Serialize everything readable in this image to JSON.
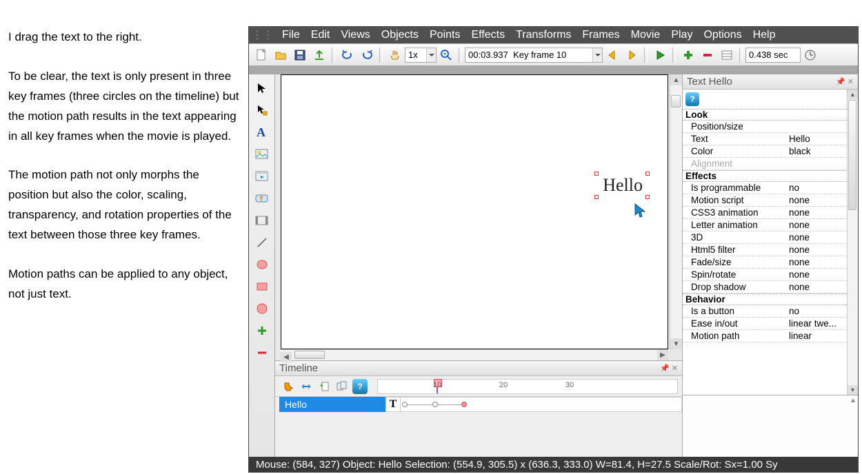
{
  "tutorial": {
    "p1": "I drag the text to the right.",
    "p2": "To be clear, the text is only present in three key frames (three circles on the timeline) but the motion path results in the text appearing in all key frames when the movie is played.",
    "p3": "The motion path not only morphs the position but also the color, scaling, transparency, and rotation properties of the text between those three key frames.",
    "p4": "Motion paths can be applied to any object, not just text."
  },
  "menu": [
    "File",
    "Edit",
    "Views",
    "Objects",
    "Points",
    "Effects",
    "Transforms",
    "Frames",
    "Movie",
    "Play",
    "Options",
    "Help"
  ],
  "toolbar": {
    "zoom": "1x",
    "time": "00:03.937",
    "frame": "Key frame 10",
    "duration": "0.438 sec"
  },
  "canvas_text": "Hello",
  "timeline": {
    "title": "Timeline",
    "track_label": "Hello",
    "ticks": [
      10,
      20,
      30
    ]
  },
  "props": {
    "title": "Text Hello",
    "sections": {
      "look": "Look",
      "effects": "Effects",
      "behavior": "Behavior"
    },
    "rows": {
      "position": "Position/size",
      "text_k": "Text",
      "text_v": "Hello",
      "color_k": "Color",
      "color_v": "black",
      "alignment": "Alignment",
      "isprog_k": "Is programmable",
      "isprog_v": "no",
      "motion_k": "Motion script",
      "motion_v": "none",
      "css3_k": "CSS3 animation",
      "css3_v": "none",
      "letter_k": "Letter animation",
      "letter_v": "none",
      "threed_k": "3D",
      "threed_v": "none",
      "html5_k": "Html5 filter",
      "html5_v": "none",
      "fade_k": "Fade/size",
      "fade_v": "none",
      "spin_k": "Spin/rotate",
      "spin_v": "none",
      "drop_k": "Drop shadow",
      "drop_v": "none",
      "button_k": "Is a button",
      "button_v": "no",
      "ease_k": "Ease in/out",
      "ease_v": "linear twe...",
      "path_k": "Motion path",
      "path_v": "linear"
    }
  },
  "status": "Mouse: (584, 327)   Object: Hello   Selection: (554.9, 305.5) x (636.3, 333.0)   W=81.4,   H=27.5   Scale/Rot: Sx=1.00 Sy"
}
